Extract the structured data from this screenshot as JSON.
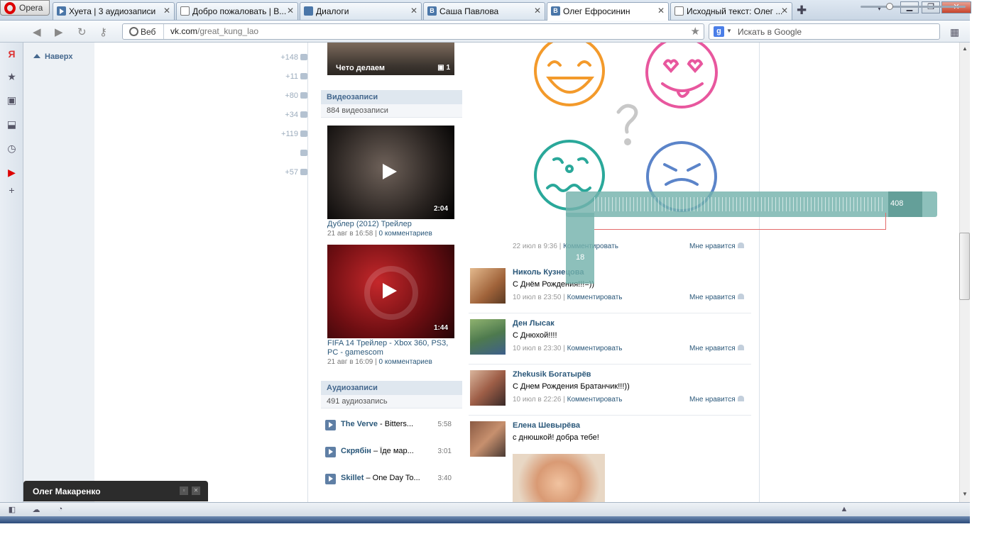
{
  "browser": {
    "opera_label": "Opera",
    "tabs": [
      {
        "label": "Хуета | 3 аудиозаписи",
        "icon": "vk-audio-icon"
      },
      {
        "label": "Добро пожаловать | В...",
        "icon": "page-icon"
      },
      {
        "label": "Диалоги",
        "icon": "messages-icon"
      },
      {
        "label": "Саша Павлова",
        "icon": "vk-icon"
      },
      {
        "label": "Олег Ефросинин",
        "icon": "vk-icon",
        "active": true
      },
      {
        "label": "Исходный текст: Олег ...",
        "icon": "page-icon"
      }
    ],
    "web_label": "Веб",
    "url_host": "vk.com",
    "url_path": "/great_kung_lao",
    "search_placeholder": "Искать в Google"
  },
  "left": {
    "naverh": "Наверх",
    "counters": [
      "+148",
      "+11",
      "+80",
      "+34",
      "+119",
      "",
      "+57"
    ]
  },
  "album": {
    "caption": "Чето делаем",
    "count": "1"
  },
  "videos": {
    "header": "Видеозаписи",
    "count": "884 видеозаписи",
    "items": [
      {
        "duration": "2:04",
        "title": "Дублер (2012) Трейлер",
        "date": "21 авг в 16:58",
        "comments": "0 комментариев"
      },
      {
        "duration": "1:44",
        "title": "FIFA 14 Трейлер - Xbox 360, PS3, PC - gamescom",
        "date": "21 авг в 16:09",
        "comments": "0 комментариев"
      }
    ]
  },
  "audio": {
    "header": "Аудиозаписи",
    "count": "491 аудиозапись",
    "items": [
      {
        "artist": "The Verve",
        "title": " - Bitters...",
        "duration": "5:58"
      },
      {
        "artist": "Скрябін",
        "title": " – Їде мар...",
        "duration": "3:01"
      },
      {
        "artist": "Skillet",
        "title": " – One Day To...",
        "duration": "3:40"
      }
    ]
  },
  "top_post": {
    "date": "22 июл в 9:36",
    "comment": "Комментировать",
    "like": "Мне нравится"
  },
  "posts": [
    {
      "name": "Николь Кузнецова",
      "text": "С Днём Рождения!!!=))",
      "date": "10 июл в 23:50",
      "comment": "Комментировать",
      "like": "Мне нравится"
    },
    {
      "name": "Ден Лысак",
      "text": "С Днюхой!!!!",
      "date": "10 июл в 23:30",
      "comment": "Комментировать",
      "like": "Мне нравится"
    },
    {
      "name": "Zhekusik Богатырёв",
      "text": "С Днем Рождения Братанчик!!!))",
      "date": "10 июл в 22:26",
      "comment": "Комментировать",
      "like": "Мне нравится"
    },
    {
      "name": "Елена Шевырёва",
      "text": "с днюшкой! добра тебе!"
    }
  ],
  "chat": {
    "name": "Олег Макаренко"
  },
  "ruler": {
    "width": "408",
    "height": "18"
  },
  "colors": {
    "vk_link": "#2b587a",
    "vk_header_bg": "#dfe7ef",
    "ruler": "#74b2ac"
  }
}
